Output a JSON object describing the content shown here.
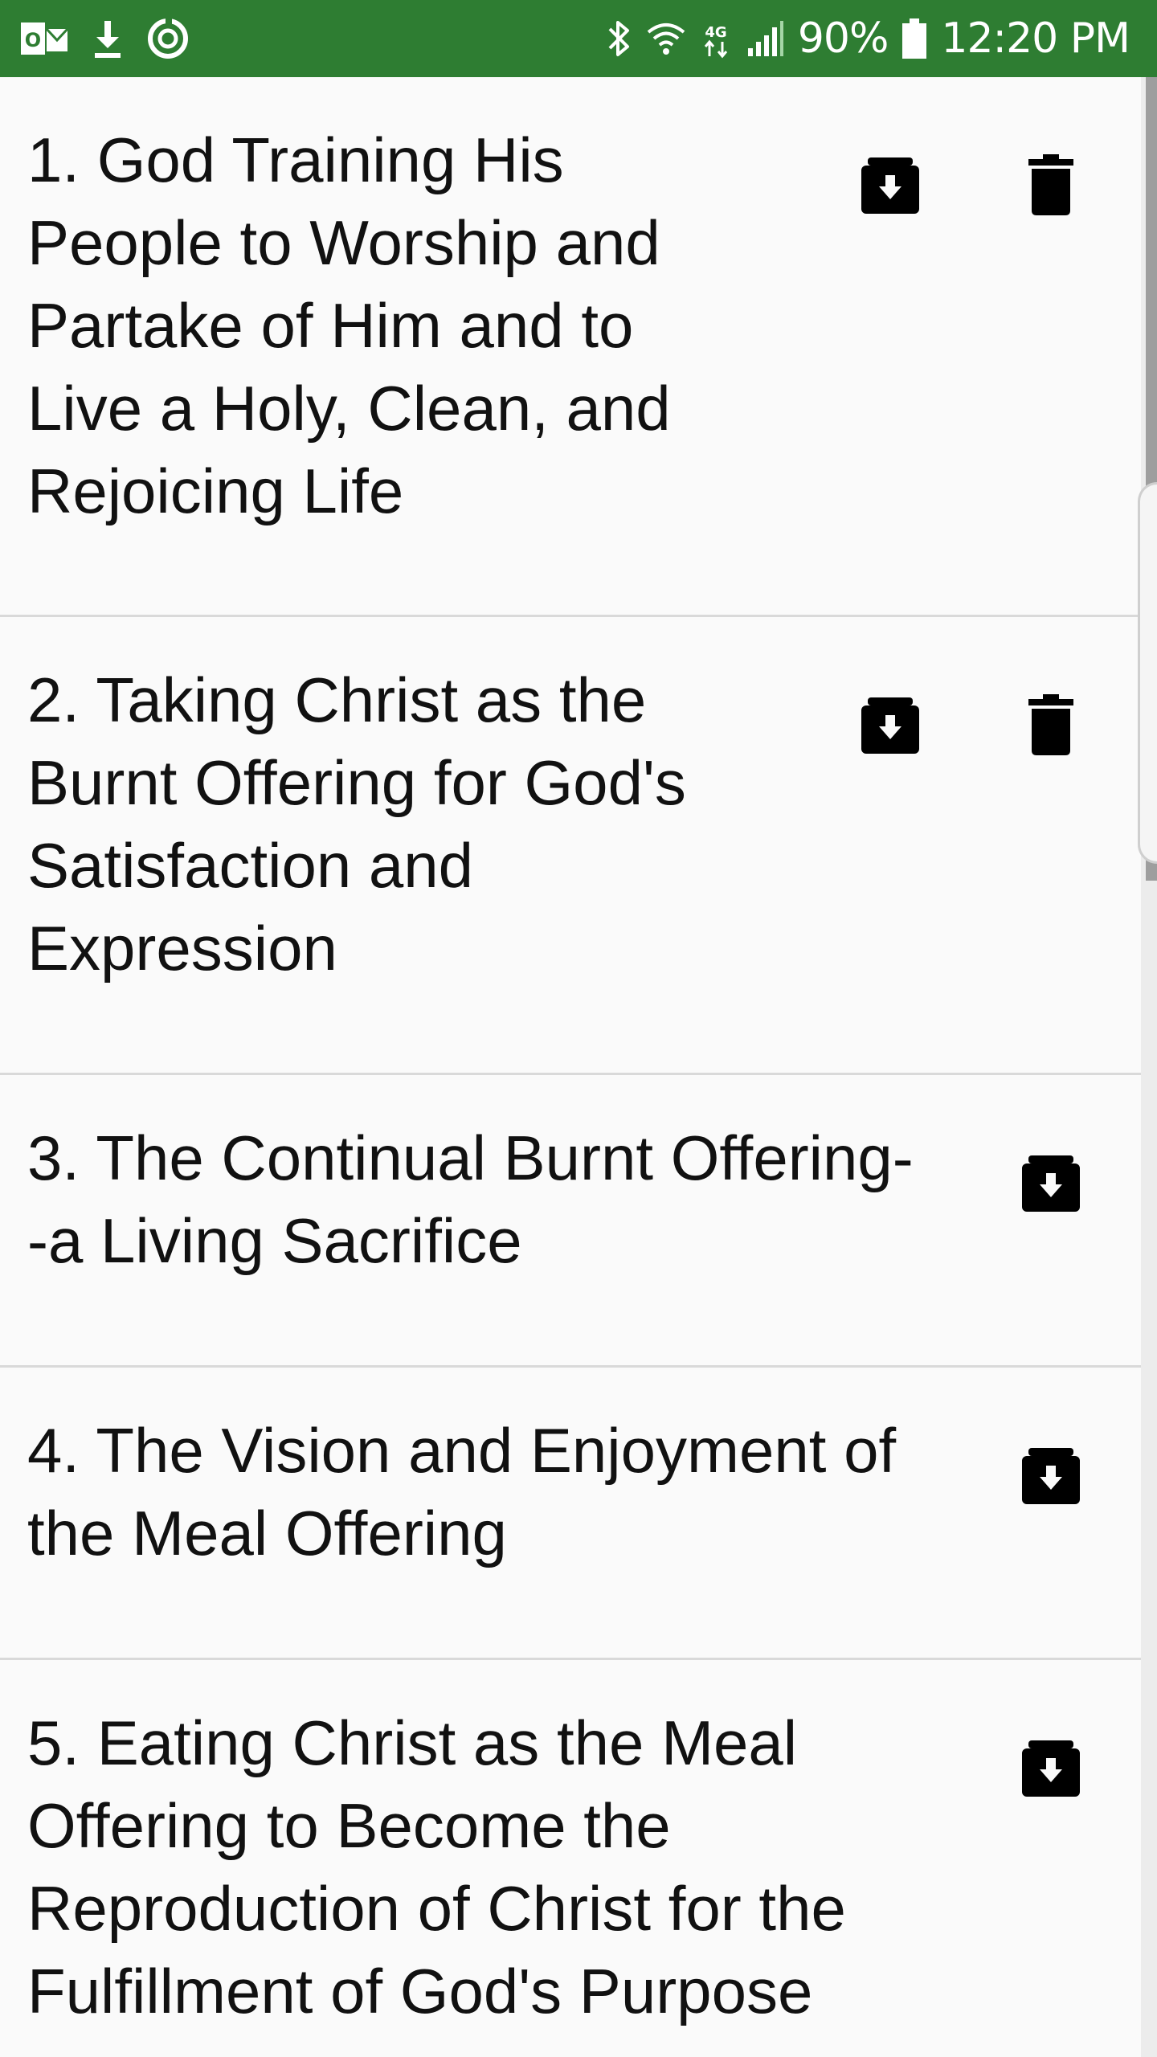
{
  "status_bar": {
    "time": "12:20 PM",
    "battery": "90%",
    "icons": [
      "outlook-icon",
      "download-icon",
      "sync-icon",
      "bluetooth-icon",
      "wifi-icon",
      "lte-icon",
      "signal-icon",
      "battery-icon"
    ]
  },
  "colors": {
    "status_bar": "#2e7d32",
    "background": "#fafafa",
    "text": "#111111",
    "divider": "#d9d9d9"
  },
  "messages": [
    {
      "title": "1. God Training His People to Worship and Partake of Him and to Live a Holy, Clean, and Rejoicing Life",
      "actions": [
        "archive-icon",
        "trash-icon"
      ]
    },
    {
      "title": "2. Taking Christ as the Burnt Offering for God's Satisfaction and Expression",
      "actions": [
        "archive-icon",
        "trash-icon"
      ]
    },
    {
      "title": "3. The Continual Burnt Offering--a Living Sacrifice",
      "actions": [
        "archive-icon"
      ]
    },
    {
      "title": "4. The Vision and Enjoyment of the Meal Offering",
      "actions": [
        "archive-icon"
      ]
    },
    {
      "title": "5. Eating Christ as the Meal Offering to Become the Reproduction of Christ for the Fulfillment of God's Purpose",
      "actions": [
        "archive-icon"
      ]
    }
  ]
}
